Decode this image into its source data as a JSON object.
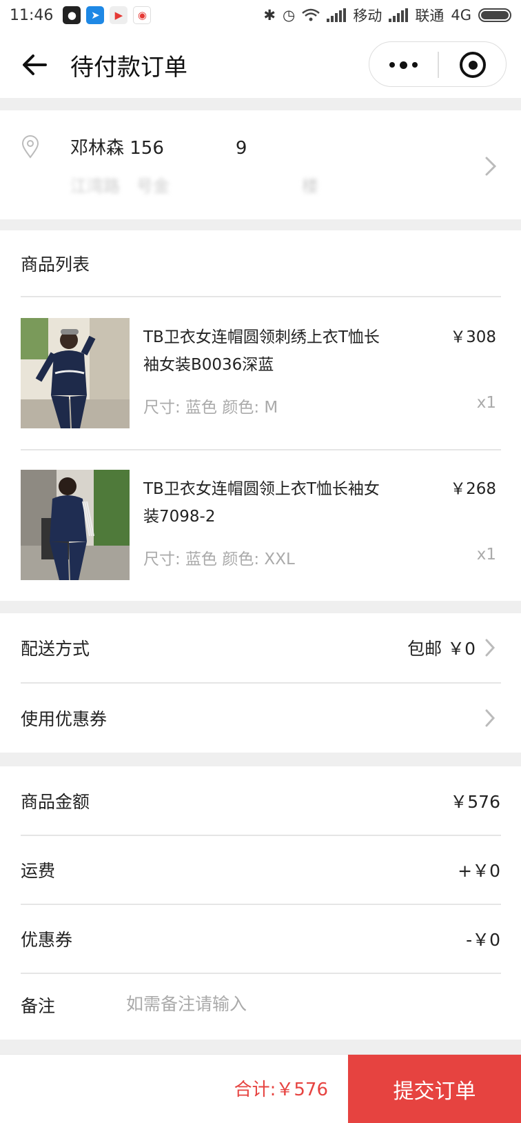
{
  "status_bar": {
    "time": "11:46",
    "carrier1": "移动",
    "carrier2": "联通",
    "network": "4G"
  },
  "nav": {
    "title": "待付款订单"
  },
  "address": {
    "name_phone": "邓林森 156    9",
    "detail": "江湾路 号金        楼 "
  },
  "products": {
    "title": "商品列表",
    "items": [
      {
        "name": "TB卫衣女连帽圆领刺绣上衣T恤长袖女装B0036深蓝",
        "price": "￥308",
        "spec": "尺寸: 蓝色 颜色: M",
        "qty": "x1"
      },
      {
        "name": "TB卫衣女连帽圆领上衣T恤长袖女装7098-2",
        "price": "￥268",
        "spec": "尺寸: 蓝色 颜色: XXL",
        "qty": "x1"
      }
    ]
  },
  "options": {
    "shipping_label": "配送方式",
    "shipping_value": "包邮 ￥0",
    "coupon_label": "使用优惠券"
  },
  "summary": {
    "goods_label": "商品金额",
    "goods_value": "￥576",
    "freight_label": "运费",
    "freight_value": "+￥0",
    "coupon_label": "优惠券",
    "coupon_value": "-￥0",
    "remark_label": "备注",
    "remark_placeholder": "如需备注请输入"
  },
  "footer": {
    "total": "合计:￥576",
    "submit_label": "提交订单"
  },
  "colors": {
    "accent": "#e64340",
    "airmail_red": "#e05a5a",
    "airmail_blue": "#4b8ee8"
  }
}
